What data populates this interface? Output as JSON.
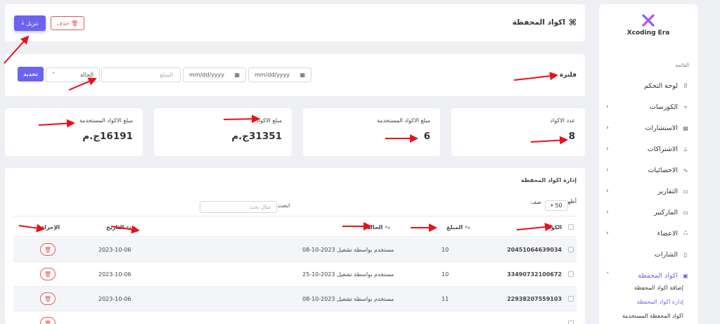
{
  "brand": {
    "name": "Xcoding Era"
  },
  "sidebar": {
    "section_label": "القائمة",
    "items": [
      {
        "label": "لوحة التحكم",
        "icon": "grid-icon",
        "chevron": false
      },
      {
        "label": "الكورسات",
        "icon": "basket-icon",
        "chevron": true
      },
      {
        "label": "الاستشارات",
        "icon": "document-icon",
        "chevron": true
      },
      {
        "label": "الاشتراكات",
        "icon": "hierarchy-icon",
        "chevron": true
      },
      {
        "label": "الاحصائيات",
        "icon": "trend-icon",
        "chevron": true
      },
      {
        "label": "التقارير",
        "icon": "archive-icon",
        "chevron": true
      },
      {
        "label": "الماركتير",
        "icon": "archive-icon",
        "chevron": true
      },
      {
        "label": "الاعضاء",
        "icon": "users-icon",
        "chevron": true
      },
      {
        "label": "الشارات",
        "icon": "bookmark-icon",
        "chevron": false
      },
      {
        "label": "اكواد المحفظة",
        "icon": "wallet-icon",
        "chevron": true,
        "active": true
      }
    ],
    "sub_items": [
      {
        "label": "إضافة اكواد المحفظة"
      },
      {
        "label": "إدارة اكواد المحفظة",
        "active": true
      },
      {
        "label": "اكواد المحفظة المستخدمة"
      }
    ]
  },
  "header": {
    "title": "اكواد المحفظة",
    "download_label": "تنزيل",
    "delete_label": "حذف"
  },
  "filter": {
    "title": "فلترة",
    "date_from_placeholder": "mm/dd/yyyy",
    "date_to_placeholder": "mm/dd/yyyy",
    "amount_placeholder": "المبلغ",
    "status_value": "الحالة",
    "update_label": "تحديد"
  },
  "stats": [
    {
      "label": "عدد الاكواد",
      "value": "8"
    },
    {
      "label": "مبلغ الاكواد المستخدمة",
      "value": "6"
    },
    {
      "label": "مبلغ الاكواد",
      "value": "31351ج.م"
    },
    {
      "label": "مبلغ الاكواد المستخدمة",
      "value": "16191ج.م"
    }
  ],
  "table": {
    "title": "إدارة اكواد المحفظة",
    "show_prefix": "أظهر",
    "show_suffix": "صف",
    "page_size": "50",
    "search_label": "ابحث:",
    "search_placeholder": "مثال بحث",
    "columns": {
      "code": "الكود",
      "amount": "المبلغ",
      "status": "الحالة",
      "date": "التاريخ",
      "action": "الإجراء"
    },
    "rows": [
      {
        "code": "20451064639034",
        "amount": "10",
        "status": "مستخدم بواسطة تشغيل 2023-10-08",
        "date": "2023-10-06"
      },
      {
        "code": "33490732100672",
        "amount": "10",
        "status": "مستخدم بواسطة تشغيل 2023-10-25",
        "date": "2023-10-06"
      },
      {
        "code": "22938207559103",
        "amount": "11",
        "status": "مستخدم بواسطة تشغيل 2023-10-08",
        "date": "2023-10-06"
      }
    ]
  }
}
